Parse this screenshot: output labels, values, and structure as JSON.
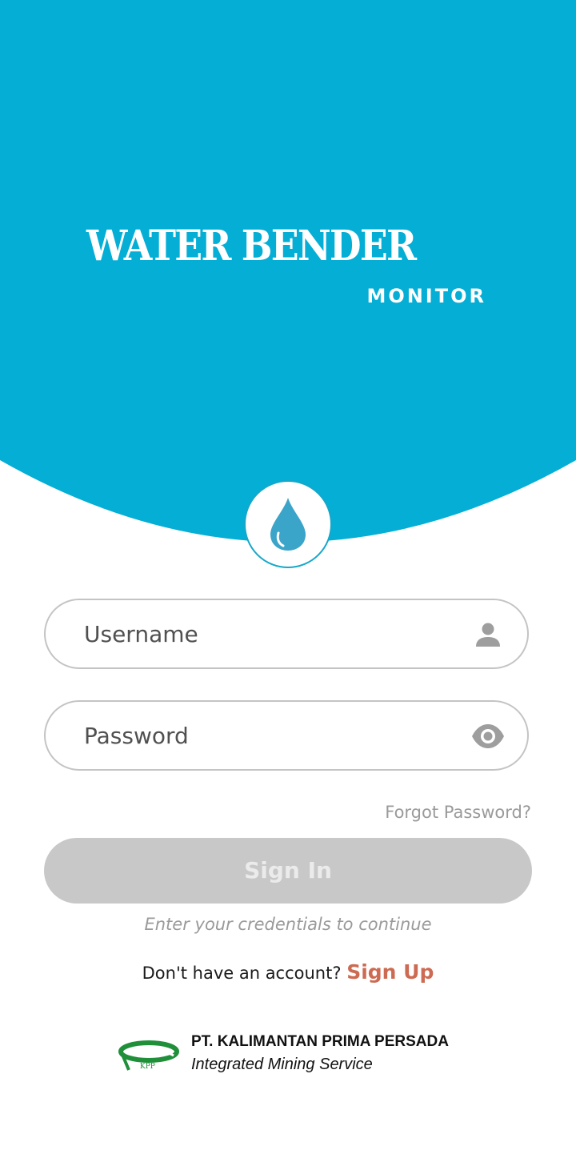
{
  "colors": {
    "brand_blue": "#04aed5",
    "accent_link": "#cd6a52",
    "button_disabled": "#c8c8c8",
    "kpp_green": "#1f8f3a"
  },
  "header": {
    "app_title": "WATER BENDER",
    "app_subtitle": "MONITOR",
    "badge_icon": "water-drop-icon"
  },
  "form": {
    "username_placeholder": "Username",
    "username_icon": "person-icon",
    "password_placeholder": "Password",
    "password_icon": "eye-icon",
    "forgot_password": "Forgot Password?",
    "sign_in_label": "Sign In",
    "sign_in_enabled": false,
    "hint": "Enter your credentials to continue"
  },
  "signup": {
    "prompt": "Don't have an account? ",
    "link": "Sign Up"
  },
  "footer": {
    "logo_text": "KPP",
    "company_name": "PT. KALIMANTAN PRIMA PERSADA",
    "tagline": "Integrated Mining Service"
  }
}
